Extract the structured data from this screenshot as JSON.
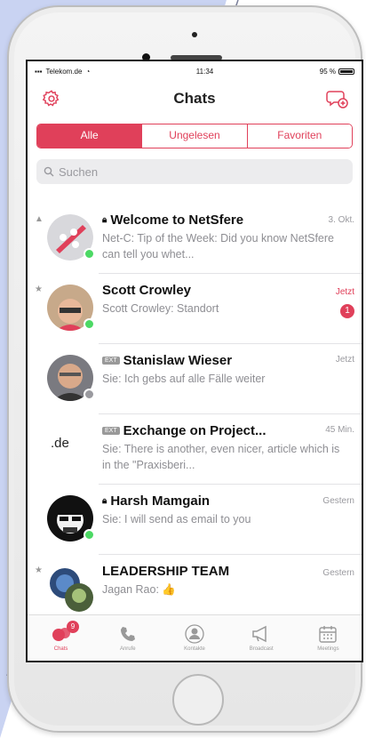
{
  "status": {
    "carrier": "Telekom.de",
    "time": "11:34",
    "battery": "95 %"
  },
  "header": {
    "title": "Chats"
  },
  "segments": [
    {
      "label": "Alle",
      "active": true
    },
    {
      "label": "Ungelesen",
      "active": false
    },
    {
      "label": "Favoriten",
      "active": false
    }
  ],
  "search": {
    "placeholder": "Suchen"
  },
  "chats": [
    {
      "title": "Welcome to NetSfere",
      "time": "3. Okt.",
      "preview": "Net-C: Tip of the Week: Did you know NetSfere can tell you whet...",
      "locked": true,
      "starred": true,
      "presence": "online"
    },
    {
      "title": "Scott Crowley",
      "time": "Jetzt",
      "preview": "Scott Crowley: Standort",
      "unread": "1",
      "starred": true,
      "presence": "online"
    },
    {
      "title": "Stanislaw Wieser",
      "time": "Jetzt",
      "preview": "Sie: Ich gebs auf alle Fälle weiter",
      "tag": "EXT",
      "presence": "away"
    },
    {
      "title": "Exchange on Project...",
      "time": "45 Min.",
      "preview": "Sie: There is another, even nicer, article which is in the \"Praxisberi...",
      "tag": "EXT",
      "avatar_text": ".de"
    },
    {
      "title": "Harsh Mamgain",
      "time": "Gestern",
      "preview": "Sie: I will send as email to you",
      "locked": true
    },
    {
      "title": "LEADERSHIP TEAM",
      "time": "Gestern",
      "preview": "Jagan Rao: 👍",
      "starred": true
    }
  ],
  "tabs": [
    {
      "label": "Chats",
      "badge": "9",
      "icon": "chats-icon"
    },
    {
      "label": "Anrufe",
      "icon": "phone-icon"
    },
    {
      "label": "Kontakte",
      "icon": "contacts-icon"
    },
    {
      "label": "Broadcast",
      "icon": "megaphone-icon"
    },
    {
      "label": "Meetings",
      "icon": "calendar-icon"
    }
  ],
  "colors": {
    "accent": "#e0405a",
    "online": "#4cd964",
    "away": "#9a9a9f"
  }
}
